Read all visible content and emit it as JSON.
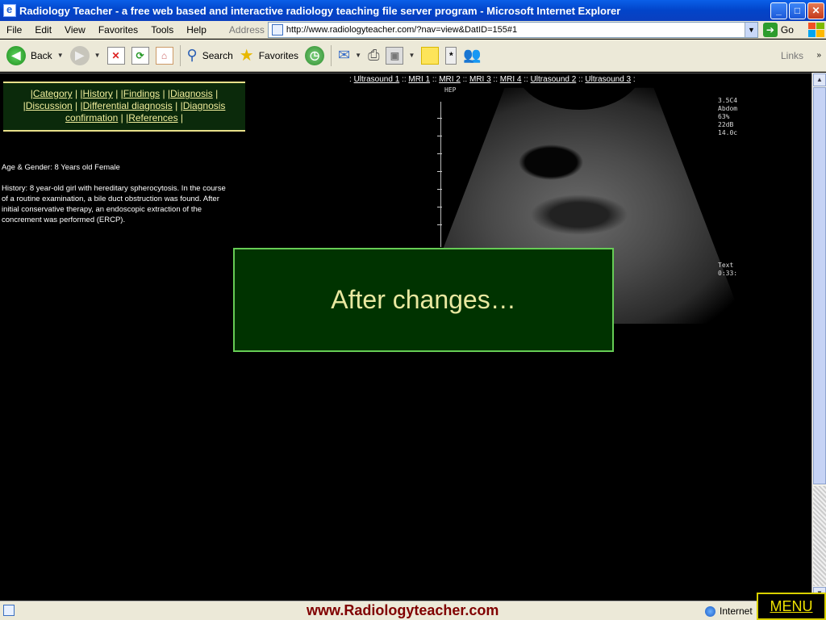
{
  "window": {
    "title": "Radiology Teacher - a free web based and interactive radiology teaching file server program - Microsoft Internet Explorer",
    "minimize": "_",
    "maximize": "□",
    "close": "✕"
  },
  "menubar": {
    "items": [
      "File",
      "Edit",
      "View",
      "Favorites",
      "Tools",
      "Help"
    ],
    "address_label": "Address",
    "url": "http://www.radiologyteacher.com/?nav=view&DatID=155#1",
    "go_label": "Go"
  },
  "toolbar": {
    "back_label": "Back",
    "search_label": "Search",
    "favorites_label": "Favorites",
    "links_label": "Links",
    "icons": [
      "back-icon",
      "forward-icon",
      "stop-icon",
      "refresh-icon",
      "home-icon",
      "search-icon",
      "favorites-icon",
      "history-icon",
      "mail-icon",
      "print-icon",
      "edit-icon",
      "note-icon",
      "messenger-icon",
      "discuss-icon"
    ]
  },
  "nav": {
    "line1": [
      "Category",
      "History",
      "Findings",
      "Diagnosis"
    ],
    "line2": [
      "Discussion",
      "Differential diagnosis",
      "Diagnosis"
    ],
    "line3": [
      "confirmation",
      "References"
    ]
  },
  "patient": {
    "age_gender": "Age & Gender: 8 Years old Female",
    "history": "History: 8 year-old girl with hereditary spherocytosis. In the course of a routine examination, a bile duct obstruction was found. After initial conservative therapy, an endoscopic extraction of the concrement was performed (ERCP)."
  },
  "image_tabs": [
    "Ultrasound 1",
    "MRI 1",
    "MRI 2",
    "MRI 3",
    "MRI 4",
    "Ultrasound 2",
    "Ultrasound 3"
  ],
  "ultrasound": {
    "top_label": "HEP",
    "info": "3.5C4\nAbdom\n63%\n22dB\n14.0c",
    "bottom_info": "Text\n0:33:"
  },
  "overlay": {
    "text": "After changes…"
  },
  "status": {
    "site": "www.Radiologyteacher.com",
    "zone": "Internet",
    "menu_label": "MENU"
  }
}
